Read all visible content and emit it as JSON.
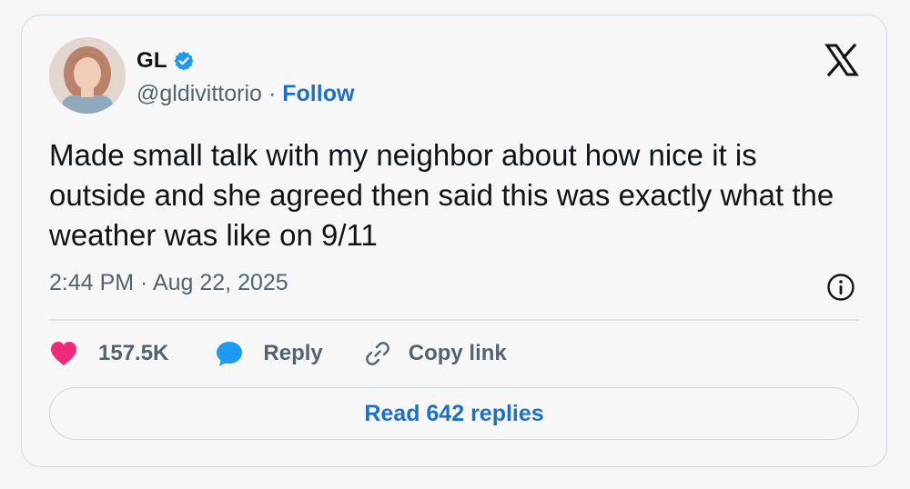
{
  "author": {
    "name": "GL",
    "handle": "@gldivittorio",
    "separator": "·",
    "follow_label": "Follow",
    "verified": true
  },
  "tweet": {
    "text": "Made small talk with my neighbor about how nice it is outside and she agreed then said this was exactly what the weather was like on 9/11",
    "timestamp": "2:44 PM · Aug 22, 2025"
  },
  "actions": {
    "likes": "157.5K",
    "reply_label": "Reply",
    "copy_link_label": "Copy link"
  },
  "read_replies_label": "Read 642 replies",
  "colors": {
    "accent": "#1d6fc7",
    "heart": "#f02a7a",
    "reply_bubble": "#1d9bf0",
    "text": "#0f1419",
    "muted": "#536471"
  },
  "icons": [
    "verified-badge-icon",
    "x-logo-icon",
    "info-icon",
    "heart-icon",
    "reply-icon",
    "link-icon"
  ]
}
